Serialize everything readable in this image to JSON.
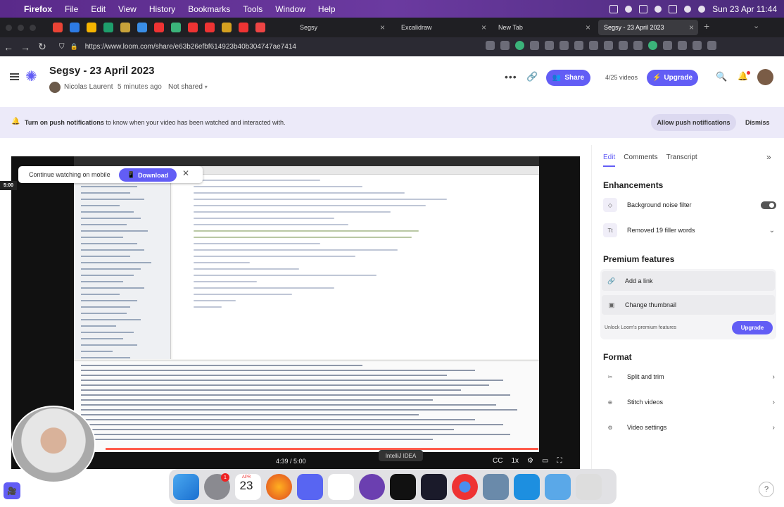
{
  "menubar": {
    "app": "Firefox",
    "items": [
      "File",
      "Edit",
      "View",
      "History",
      "Bookmarks",
      "Tools",
      "Window",
      "Help"
    ],
    "clock": "Sun 23 Apr 11:44"
  },
  "tabs": [
    {
      "label": "Segsy"
    },
    {
      "label": "Excalidraw"
    },
    {
      "label": "New Tab"
    },
    {
      "label": "Segsy - 23 April 2023"
    }
  ],
  "url": "https://www.loom.com/share/e63b26efbf614923b40b304747ae7414",
  "video": {
    "title": "Segsy - 23 April 2023",
    "author": "Nicolas Laurent",
    "time_ago": "5 minutes ago",
    "visibility": "Not shared",
    "share_label": "Share",
    "count": "4/25 videos",
    "upgrade_label": "Upgrade"
  },
  "notice": {
    "bold": "Turn on push notifications",
    "rest": " to know when your video has been watched and interacted with.",
    "allow": "Allow push notifications",
    "dismiss": "Dismiss"
  },
  "player": {
    "mobile_prompt": "Continue watching on mobile",
    "download": "Download",
    "time_badge": "5:00",
    "timecode": "4:39 / 5:00",
    "progress": 0.93,
    "speed": "1x",
    "tooltip": "IntelliJ IDEA"
  },
  "dock": {
    "badge": "1",
    "calendar_day": "23",
    "calendar_month": "APR"
  },
  "sidebar": {
    "tabs": [
      "Edit",
      "Comments",
      "Transcript"
    ],
    "enhancements_title": "Enhancements",
    "noise_filter": "Background noise filter",
    "filler_words": "Removed 19 filler words",
    "premium_title": "Premium features",
    "add_link": "Add a link",
    "change_thumb": "Change thumbnail",
    "unlock": "Unlock Loom's premium features",
    "upgrade": "Upgrade",
    "format_title": "Format",
    "split": "Split and trim",
    "stitch": "Stitch videos",
    "settings": "Video settings"
  },
  "colors": {
    "accent": "#625df5",
    "progress": "#ff5a4a"
  }
}
